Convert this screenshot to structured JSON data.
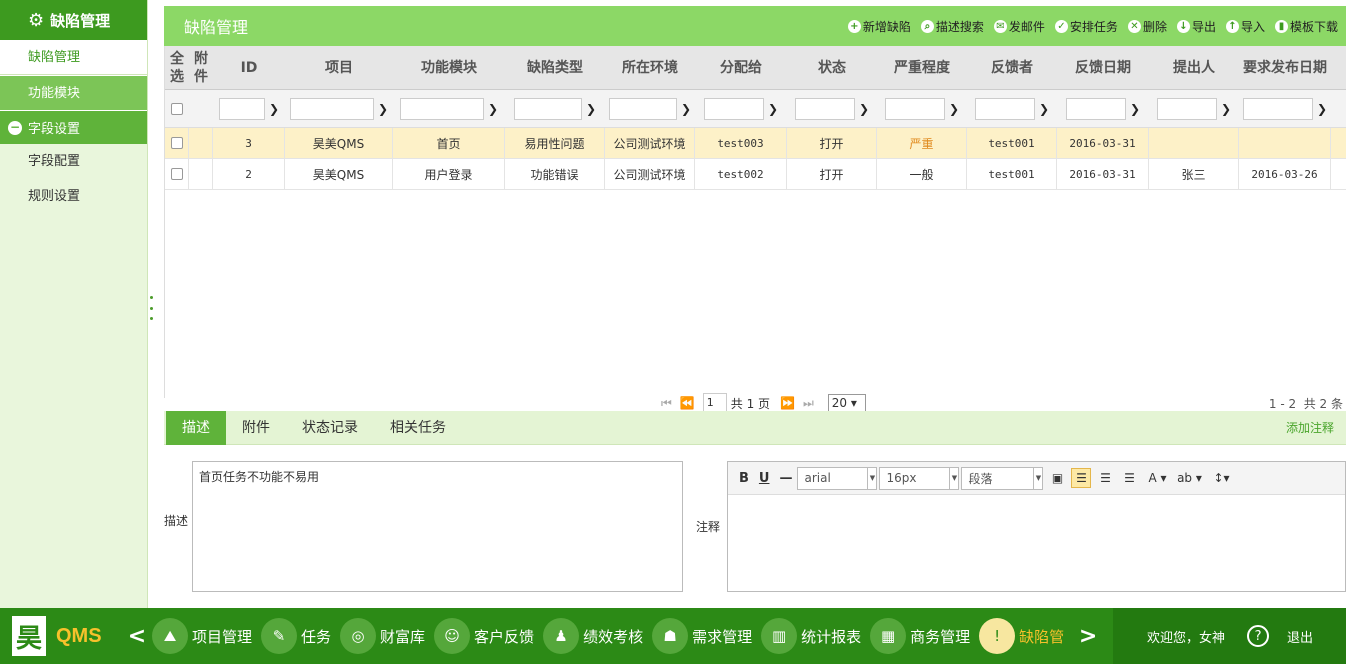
{
  "sidebar": {
    "title": "缺陷管理",
    "items": [
      {
        "label": "缺陷管理"
      },
      {
        "label": "功能模块"
      }
    ],
    "group": {
      "label": "字段设置",
      "children": [
        {
          "label": "字段配置"
        },
        {
          "label": "规则设置"
        }
      ]
    }
  },
  "toolbar": {
    "title": "缺陷管理",
    "actions": [
      {
        "label": "新增缺陷",
        "icon": "plus-icon"
      },
      {
        "label": "描述搜索",
        "icon": "search-icon"
      },
      {
        "label": "发邮件",
        "icon": "mail-icon"
      },
      {
        "label": "安排任务",
        "icon": "check-icon"
      },
      {
        "label": "删除",
        "icon": "delete-icon"
      },
      {
        "label": "导出",
        "icon": "download-icon"
      },
      {
        "label": "导入",
        "icon": "upload-icon"
      },
      {
        "label": "模板下载",
        "icon": "template-icon"
      }
    ]
  },
  "table": {
    "headers": {
      "selectAll": "全选",
      "attachment": "附件",
      "id": "ID",
      "project": "项目",
      "module": "功能模块",
      "type": "缺陷类型",
      "env": "所在环境",
      "assignee": "分配给",
      "status": "状态",
      "severity": "严重程度",
      "reporter": "反馈者",
      "date": "反馈日期",
      "submitter": "提出人",
      "release": "要求发布日期"
    },
    "rows": [
      {
        "id": "3",
        "project": "昊美QMS",
        "module": "首页",
        "type": "易用性问题",
        "env": "公司测试环境",
        "assignee": "test003",
        "status": "打开",
        "severity": "严重",
        "reporter": "test001",
        "date": "2016-03-31",
        "submitter": "",
        "release": "",
        "selected": true
      },
      {
        "id": "2",
        "project": "昊美QMS",
        "module": "用户登录",
        "type": "功能错误",
        "env": "公司测试环境",
        "assignee": "test002",
        "status": "打开",
        "severity": "一般",
        "reporter": "test001",
        "date": "2016-03-31",
        "submitter": "张三",
        "release": "2016-03-26",
        "selected": false
      }
    ]
  },
  "pager": {
    "page": "1",
    "total_pages": "共 1 页",
    "page_size": "20",
    "summary": "1 - 2  共 2 条"
  },
  "tabs": [
    {
      "label": "描述"
    },
    {
      "label": "附件"
    },
    {
      "label": "状态记录"
    },
    {
      "label": "相关任务"
    }
  ],
  "add_note": "添加注释",
  "detail": {
    "desc_label": "描述",
    "desc_text": "首页任务不功能不易用",
    "note_label": "注释",
    "font": "arial",
    "size": "16px",
    "block": "段落"
  },
  "bottom": {
    "logo_text": "QMS",
    "modules": [
      {
        "label": "项目管理",
        "icon": "chart-icon"
      },
      {
        "label": "任务",
        "icon": "pencil-icon"
      },
      {
        "label": "财富库",
        "icon": "coins-icon"
      },
      {
        "label": "客户反馈",
        "icon": "feedback-icon"
      },
      {
        "label": "绩效考核",
        "icon": "person-icon"
      },
      {
        "label": "需求管理",
        "icon": "hierarchy-icon"
      },
      {
        "label": "统计报表",
        "icon": "report-icon"
      },
      {
        "label": "商务管理",
        "icon": "business-icon"
      },
      {
        "label": "缺陷管",
        "icon": "warning-icon"
      }
    ],
    "welcome": "欢迎您，女神",
    "logout": "退出"
  },
  "colors": {
    "brand": "#3d9a1f",
    "toolbar": "#8cd866",
    "selected_row": "#fdf1c8",
    "severity_high": "#e08a1e"
  }
}
